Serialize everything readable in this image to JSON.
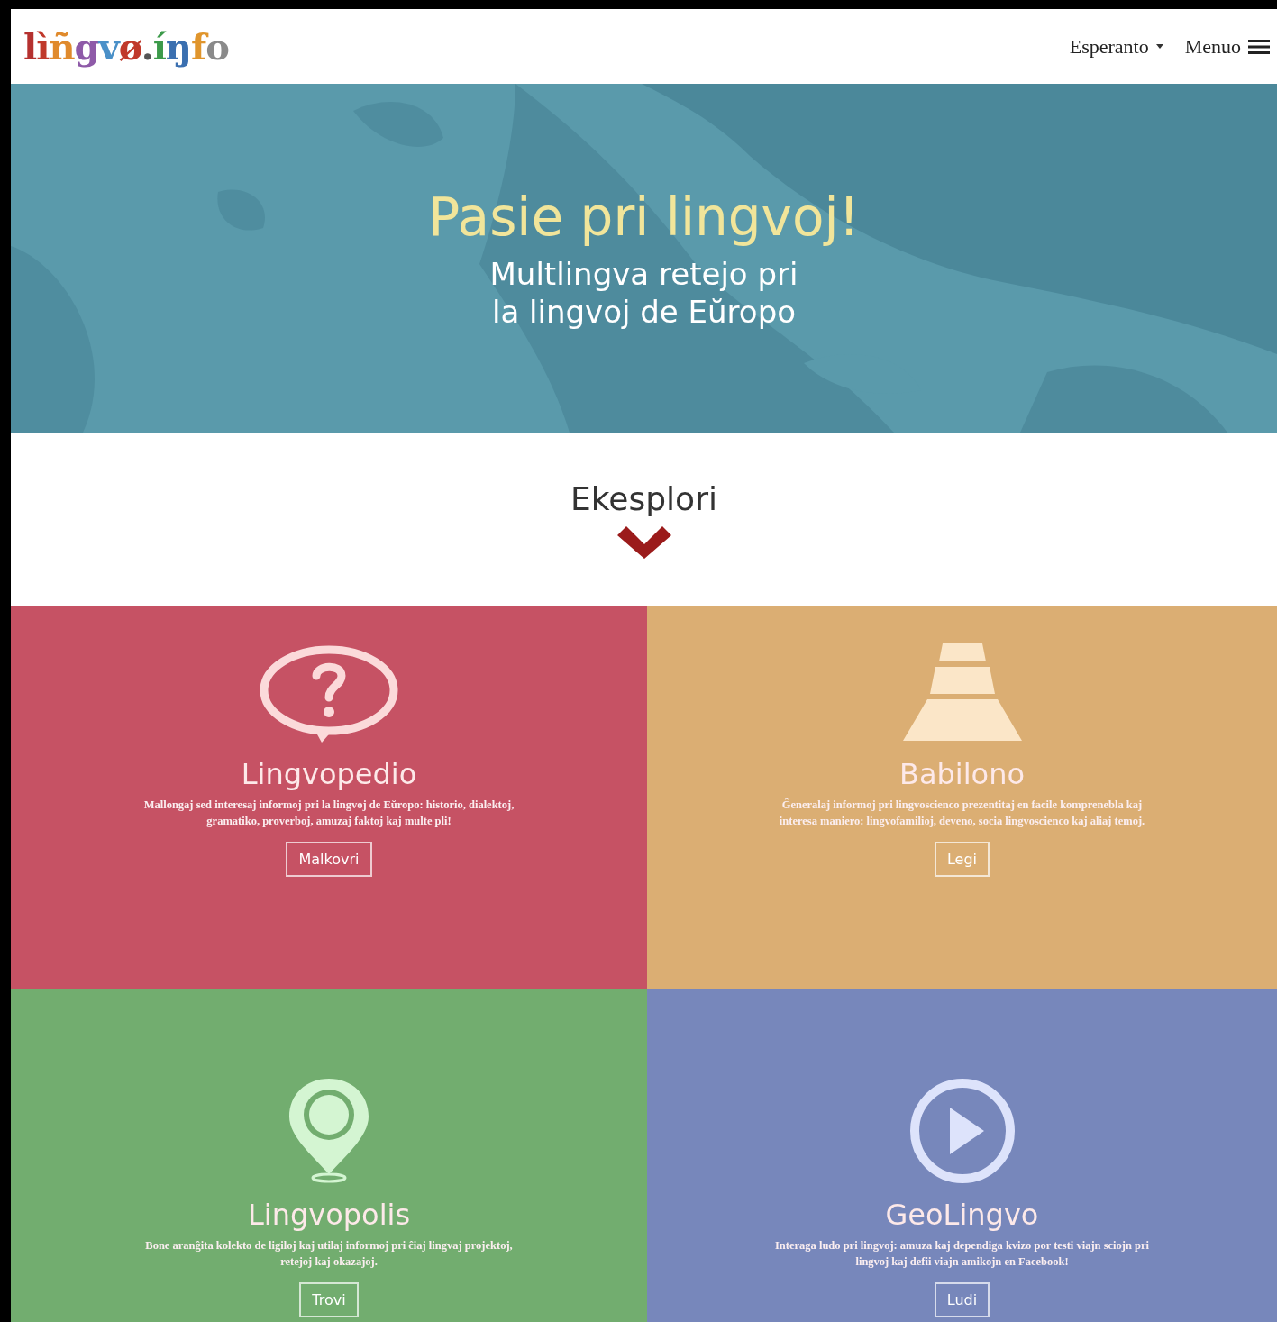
{
  "header": {
    "logo": [
      {
        "text": "l",
        "color": "#b5312f"
      },
      {
        "text": "ì",
        "color": "#c0392b"
      },
      {
        "text": "ñ",
        "color": "#e08a2c"
      },
      {
        "text": "g",
        "color": "#8e5aa8"
      },
      {
        "text": "v",
        "color": "#4a90c8"
      },
      {
        "text": "ø",
        "color": "#c0392b"
      },
      {
        "text": ".",
        "color": "#555555"
      },
      {
        "text": "í",
        "color": "#3c9a4a"
      },
      {
        "text": "ŋ",
        "color": "#3a6fb0"
      },
      {
        "text": "f",
        "color": "#e0952c"
      },
      {
        "text": "o",
        "color": "#8a8a8a"
      }
    ],
    "language": "Esperanto",
    "menu": "Menuo"
  },
  "hero": {
    "kind": "picture",
    "title": "Pasie pri lingvoj!",
    "subtitle_lines": [
      "Multlingva retejo pri",
      "la lingvoj de Eŭropo"
    ]
  },
  "explore": {
    "title": "Ekesplori"
  },
  "tiles": [
    {
      "kind": "question",
      "color": "#c65264",
      "title": "Lingvopedio",
      "text": "Mallongaj sed interesaj informoj pri la lingvoj de Eŭropo: historio, dialektoj, gramatiko, proverboj, amuzaj faktoj kaj multe pli!",
      "button": "Malkovri"
    },
    {
      "kind": "pyramid",
      "color": "#dbae73",
      "title": "Babilono",
      "text": "Ĝeneralaj informoj pri lingvoscienco prezentitaj en facile komprenebla kaj interesa maniero: lingvofamilioj, deveno, socia lingvoscienco kaj aliaj temoj.",
      "button": "Legi"
    },
    {
      "kind": "pin",
      "color": "#72ad6f",
      "title": "Lingvopolis",
      "text": "Bone aranĝita kolekto de ligiloj kaj utilaj informoj pri ĉiaj lingvaj projektoj, retejoj kaj okazajoj.",
      "button": "Trovi"
    },
    {
      "kind": "play",
      "color": "#7787bb",
      "title": "GeoLingvo",
      "text": "Interaga ludo pri lingvoj: amuza kaj dependiga kvizo por testi viajn sciojn pri lingvoj kaj defii viajn amikojn en Facebook!",
      "button": "Ludi"
    }
  ]
}
